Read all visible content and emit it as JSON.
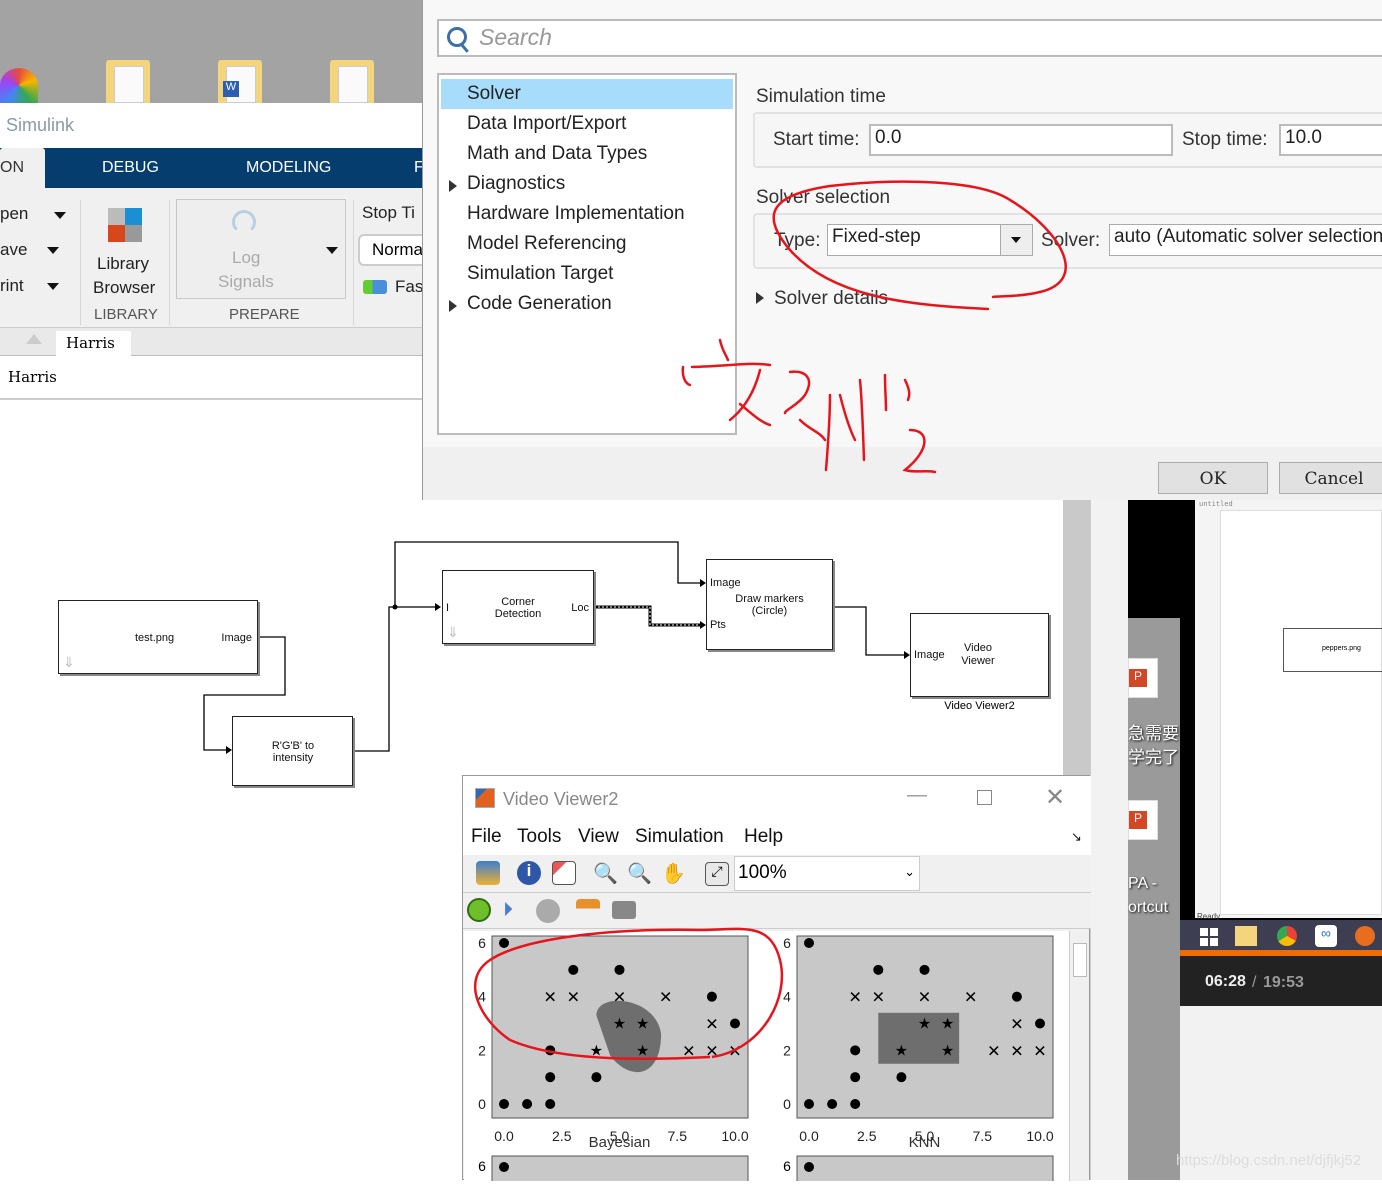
{
  "simulink": {
    "window_title": "Simulink",
    "tabs": [
      "ON",
      "DEBUG",
      "MODELING",
      "F"
    ],
    "ribbon": {
      "file_items": [
        "pen",
        "ave",
        "rint"
      ],
      "library_browser": [
        "Library",
        "Browser"
      ],
      "log_signals": [
        "Log",
        "Signals"
      ],
      "stop_time_label": "Stop Ti",
      "mode_value": "Norma",
      "fast_label": "Fas",
      "sections": [
        "LIBRARY",
        "PREPARE"
      ]
    },
    "breadcrumb_tab": "Harris",
    "address": "Harris",
    "blocks": {
      "source": {
        "name": "test.png",
        "port_out": "Image"
      },
      "rgb2gray": {
        "name": "R'G'B' to intensity"
      },
      "corner": {
        "name": "Corner Detection",
        "port_in": "I",
        "port_out": "Loc"
      },
      "markers": {
        "name": "Draw markers (Circle)",
        "port_image": "Image",
        "port_pts": "Pts"
      },
      "viewer": {
        "name": "Video Viewer",
        "port_in": "Image",
        "caption": "Video Viewer2"
      }
    }
  },
  "dialog": {
    "search_placeholder": "Search",
    "tree": [
      {
        "label": "Solver",
        "selected": true,
        "expandable": false
      },
      {
        "label": "Data Import/Export",
        "expandable": false
      },
      {
        "label": "Math and Data Types",
        "expandable": false
      },
      {
        "label": "Diagnostics",
        "expandable": true
      },
      {
        "label": "Hardware Implementation",
        "expandable": false
      },
      {
        "label": "Model Referencing",
        "expandable": false
      },
      {
        "label": "Simulation Target",
        "expandable": false
      },
      {
        "label": "Code Generation",
        "expandable": true
      }
    ],
    "simulation_time_heading": "Simulation time",
    "start_time_label": "Start time:",
    "start_time_value": "0.0",
    "stop_time_label": "Stop time:",
    "stop_time_value": "10.0",
    "solver_selection_heading": "Solver selection",
    "type_label": "Type:",
    "type_value": "Fixed-step",
    "solver_label": "Solver:",
    "solver_value": "auto (Automatic solver selection",
    "solver_details": "Solver details",
    "ok": "OK",
    "cancel": "Cancel",
    "annotation_color": "#e8141c"
  },
  "video_viewer": {
    "title": "Video Viewer2",
    "menu": [
      "File",
      "Tools",
      "View",
      "Simulation",
      "Help"
    ],
    "zoom_value": "100%",
    "plots": [
      {
        "xlabel": "Bayesian"
      },
      {
        "xlabel": "KNN"
      }
    ],
    "x_ticks": [
      "0.0",
      "2.5",
      "5.0",
      "7.5",
      "10.0"
    ],
    "y_ticks": [
      "0",
      "2",
      "4",
      "6"
    ],
    "dots": [
      [
        0,
        6
      ],
      [
        3,
        5
      ],
      [
        5,
        5
      ],
      [
        9,
        4
      ],
      [
        10,
        3
      ],
      [
        2,
        2
      ],
      [
        2,
        1
      ],
      [
        4,
        1
      ],
      [
        0,
        0
      ],
      [
        1,
        0
      ],
      [
        2,
        0
      ]
    ],
    "crosses": [
      [
        2,
        4
      ],
      [
        3,
        4
      ],
      [
        5,
        4
      ],
      [
        7,
        4
      ],
      [
        9,
        3
      ],
      [
        8,
        2
      ],
      [
        9,
        2
      ],
      [
        10,
        2
      ]
    ],
    "stars": [
      [
        5,
        3
      ],
      [
        6,
        3
      ],
      [
        4,
        2
      ],
      [
        6,
        2
      ]
    ]
  },
  "background": {
    "chinese_text": [
      "急需要",
      "学完了"
    ],
    "shortcut_text": [
      "PA -",
      "ortcut"
    ],
    "thumbnail_tab": "untitled",
    "thumbnail_block": "peppers.png",
    "thumbnail_status": "Ready",
    "video_time": "06:28",
    "video_duration": "19:53",
    "watermark": "https://blog.csdn.net/djfjkj52"
  }
}
